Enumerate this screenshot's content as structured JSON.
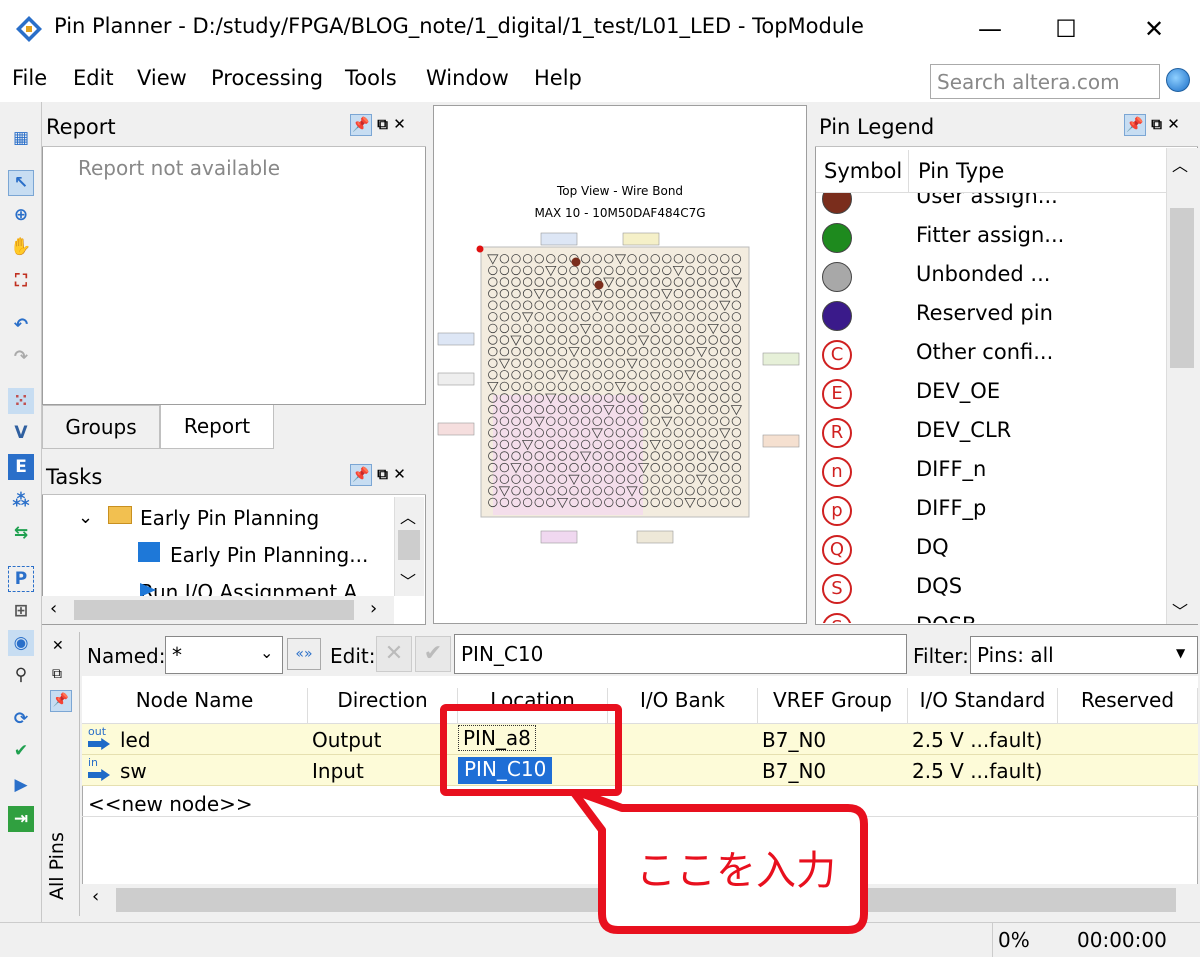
{
  "window": {
    "title": "Pin Planner - D:/study/FPGA/BLOG_note/1_digital/1_test/L01_LED - TopModule",
    "minimize": "—",
    "maximize": "☐",
    "close": "✕"
  },
  "menu": [
    "File",
    "Edit",
    "View",
    "Processing",
    "Tools",
    "Window",
    "Help"
  ],
  "search": {
    "placeholder": "Search altera.com"
  },
  "report_panel": {
    "title": "Report",
    "message": "Report not available",
    "tabs": [
      "Groups",
      "Report"
    ]
  },
  "tasks_panel": {
    "title": "Tasks",
    "items": [
      "Early Pin Planning",
      "Early Pin Planning...",
      "Run I/O Assignment A"
    ]
  },
  "package_view": {
    "title": "Top View - Wire Bond",
    "subtitle": "MAX 10 - 10M50DAF484C7G"
  },
  "legend": {
    "title": "Pin Legend",
    "col_symbol": "Symbol",
    "col_type": "Pin Type",
    "items": [
      {
        "symbol": "",
        "label": "User assign...",
        "color": "#7a2d1c"
      },
      {
        "symbol": "",
        "label": "Fitter assign...",
        "color": "#1e8a1e"
      },
      {
        "symbol": "",
        "label": "Unbonded ...",
        "color": "#a8a8a8"
      },
      {
        "symbol": "",
        "label": "Reserved pin",
        "color": "#3a1a8a"
      },
      {
        "symbol": "C",
        "label": "Other confi..."
      },
      {
        "symbol": "E",
        "label": "DEV_OE"
      },
      {
        "symbol": "R",
        "label": "DEV_CLR"
      },
      {
        "symbol": "n",
        "label": "DIFF_n"
      },
      {
        "symbol": "p",
        "label": "DIFF_p"
      },
      {
        "symbol": "Q",
        "label": "DQ"
      },
      {
        "symbol": "S",
        "label": "DQS"
      },
      {
        "symbol": "S",
        "label": "DQSB"
      }
    ]
  },
  "filterbar": {
    "named_label": "Named:",
    "named_value": "*",
    "edit_label": "Edit:",
    "edit_value": "PIN_C10",
    "filter_label": "Filter:",
    "filter_value": "Pins: all"
  },
  "pins_table": {
    "side_label": "All Pins",
    "columns": [
      "Node Name",
      "Direction",
      "Location",
      "I/O Bank",
      "VREF Group",
      "I/O Standard",
      "Reserved"
    ],
    "rows": [
      {
        "badge": "out",
        "name": "led",
        "direction": "Output",
        "location": "PIN_a8",
        "bank": "",
        "vref": "B7_N0",
        "std": "2.5 V ...fault)",
        "reserved": ""
      },
      {
        "badge": "in",
        "name": "sw",
        "direction": "Input",
        "location": "PIN_C10",
        "bank": "",
        "vref": "B7_N0",
        "std": "2.5 V ...fault)",
        "reserved": ""
      }
    ],
    "new_node": "<<new node>>"
  },
  "callout": {
    "text": "ここを入力",
    "color": "#e8101e"
  },
  "status": {
    "progress": "0%",
    "time": "00:00:00"
  }
}
